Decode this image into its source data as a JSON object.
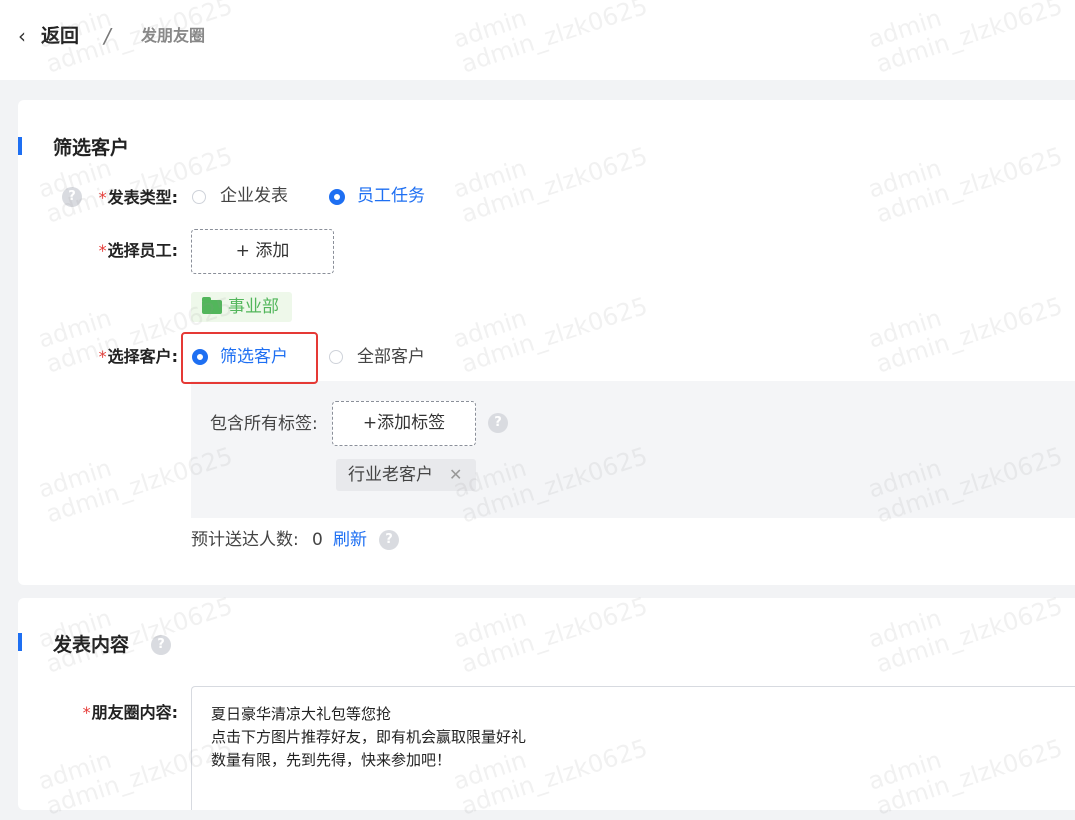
{
  "header": {
    "back_label": "返回",
    "separator": "/",
    "current": "发朋友圈"
  },
  "section_filter": {
    "title": "筛选客户",
    "publish_type": {
      "label": "发表类型:",
      "options": [
        "企业发表",
        "员工任务"
      ],
      "selected": "员工任务"
    },
    "select_staff": {
      "label": "选择员工:",
      "add_button": "+ 添加",
      "selected_tag": "事业部"
    },
    "select_customer": {
      "label": "选择客户:",
      "options": [
        "筛选客户",
        "全部客户"
      ],
      "selected": "筛选客户"
    },
    "tag_filter": {
      "label": "包含所有标签:",
      "add_button": "+添加标签",
      "tags": [
        "行业老客户"
      ]
    },
    "estimate": {
      "label": "预计送达人数:",
      "count": "0",
      "refresh": "刷新"
    }
  },
  "section_content": {
    "title": "发表内容",
    "moments_label": "朋友圈内容:",
    "moments_text": [
      "夏日豪华清凉大礼包等您抢",
      "点击下方图片推荐好友，即有机会赢取限量好礼",
      "数量有限，先到先得，快来参加吧！"
    ]
  },
  "watermark": "admin\nadmin_zlzk0625",
  "colors": {
    "accent": "#1e6ff2",
    "required": "#e53935",
    "dept_tag": "#52b65b",
    "highlight_border": "#e53935"
  }
}
